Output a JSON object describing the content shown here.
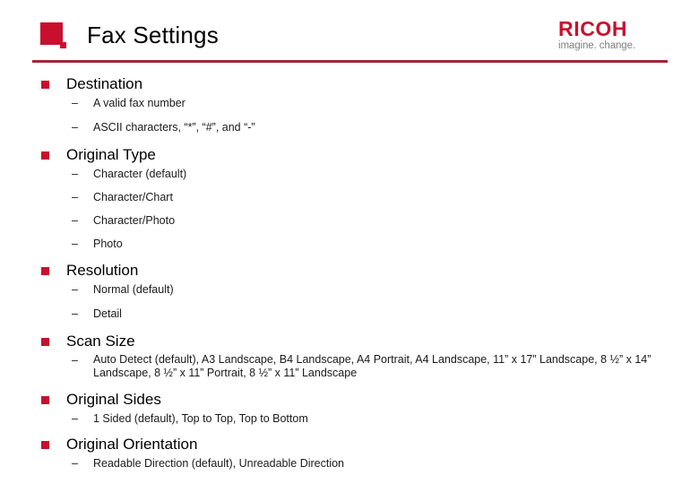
{
  "header": {
    "title": "Fax Settings",
    "logo_mark": "ricoh-square-mark",
    "brand": {
      "wordmark": "RICOH",
      "tagline": "imagine. change."
    },
    "accent_color": "#C8102E",
    "rule_color": "#A32638"
  },
  "sections": [
    {
      "heading": "Destination",
      "items": [
        "A valid fax number",
        "ASCII characters, “*”, “#”, and “-”"
      ]
    },
    {
      "heading": "Original Type",
      "items": [
        "Character (default)",
        "Character/Chart",
        "Character/Photo",
        "Photo"
      ]
    },
    {
      "heading": "Resolution",
      "items": [
        "Normal (default)",
        "Detail"
      ]
    },
    {
      "heading": "Scan Size",
      "items": [
        "Auto Detect (default), A3 Landscape, B4 Landscape, A4 Portrait, A4 Landscape, 11” x 17” Landscape, 8 ½” x 14” Landscape, 8 ½” x 11” Portrait, 8 ½” x 11” Landscape"
      ]
    },
    {
      "heading": "Original Sides",
      "items": [
        "1 Sided (default), Top to Top, Top to Bottom"
      ]
    },
    {
      "heading": "Original Orientation",
      "items": [
        "Readable Direction (default), Unreadable Direction"
      ]
    }
  ],
  "bullet_glyphs": {
    "sub_dash": "–"
  }
}
